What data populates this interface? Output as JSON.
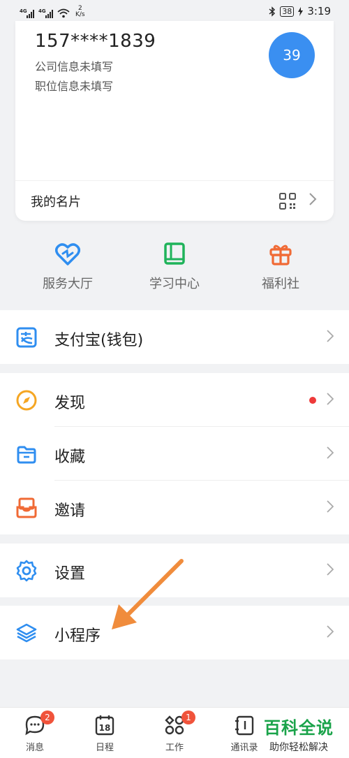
{
  "status_bar": {
    "network_left": "4G",
    "network_right": "4G",
    "speed_value": "2",
    "speed_unit": "K/s",
    "battery": "38",
    "time": "3:19"
  },
  "profile": {
    "phone": "157****1839",
    "company": "公司信息未填写",
    "position": "职位信息未填写",
    "avatar_text": "39",
    "name_card": "我的名片"
  },
  "quick_actions": [
    {
      "label": "服务大厅",
      "icon": "heart-badge-icon",
      "color": "#2f8ef0"
    },
    {
      "label": "学习中心",
      "icon": "book-icon",
      "color": "#1fb35a"
    },
    {
      "label": "福利社",
      "icon": "gift-icon",
      "color": "#f06a35"
    }
  ],
  "menu": {
    "alipay": "支付宝(钱包)",
    "discover": "发现",
    "favorites": "收藏",
    "invite": "邀请",
    "settings": "设置",
    "mini_programs": "小程序"
  },
  "tabs": [
    {
      "label": "消息",
      "badge": "2"
    },
    {
      "label": "日程",
      "calendar_day": "18"
    },
    {
      "label": "工作",
      "badge": "1"
    },
    {
      "label": "通讯录"
    }
  ],
  "watermark": {
    "title": "百科全说",
    "subtitle": "助你轻松解决"
  },
  "colors": {
    "accent_blue": "#2f8ef0",
    "badge_red": "#f0533b",
    "annotation_arrow": "#f08c3c"
  }
}
